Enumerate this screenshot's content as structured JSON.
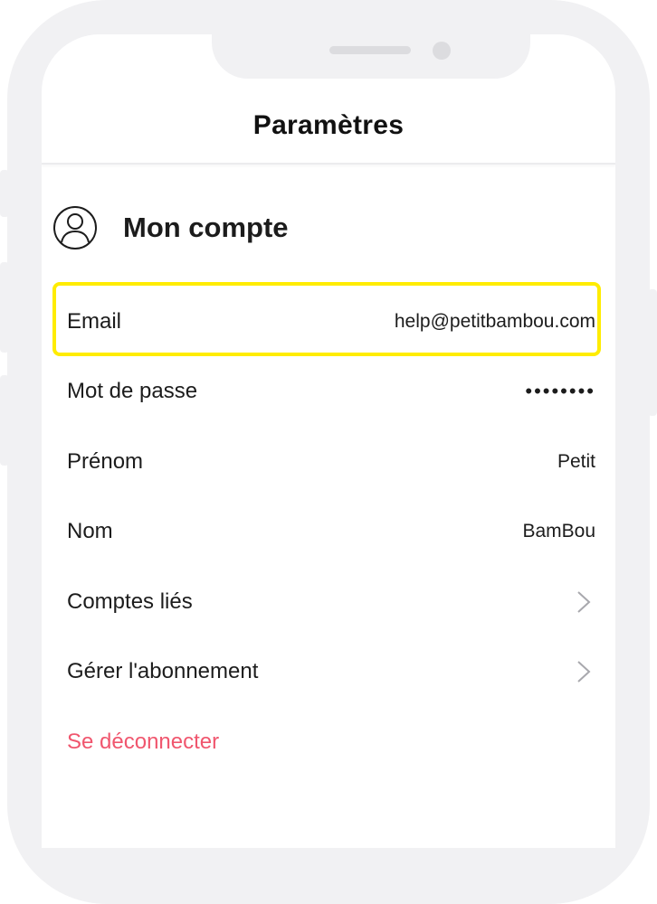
{
  "header": {
    "title": "Paramètres"
  },
  "section": {
    "title": "Mon compte",
    "icon": "user-account-icon"
  },
  "rows": [
    {
      "label": "Email",
      "value": "help@petitbambou.com"
    },
    {
      "label": "Mot de passe",
      "value": "••••••••"
    },
    {
      "label": "Prénom",
      "value": "Petit"
    },
    {
      "label": "Nom",
      "value": "BamBou"
    },
    {
      "label": "Comptes liés",
      "icon": "chevron-right-icon"
    },
    {
      "label": "Gérer l'abonnement",
      "icon": "chevron-right-icon"
    }
  ],
  "logout": {
    "label": "Se déconnecter"
  },
  "colors": {
    "highlight": "#ffec00",
    "logout": "#f0566e",
    "frame": "#f1f1f3"
  }
}
